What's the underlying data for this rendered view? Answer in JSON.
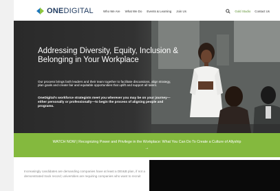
{
  "header": {
    "logo_bold": "ONE",
    "logo_light": "DIGITAL",
    "nav": [
      "Who We Are",
      "What We Do",
      "Events & Learning",
      "Join Us"
    ],
    "gold_link": "Gold Studio",
    "contact_link": "Contact Us"
  },
  "hero": {
    "title": "Addressing Diversity, Equity, Inclusion & Belonging in Your Workplace",
    "lead": "Our process brings both leaders and their team together to facilitate discussions, align strategy, plan goals and create fair and equitable opportunities that uplift and support all talent.",
    "lead2": "OneDigital's workforce strategists meet you wherever you may be on your journey—either personally or professionally—to begin the process of aligning people and programs."
  },
  "banner": {
    "text": "WATCH NOW | Recognizing Power and Privilege in the Workplace: What You Can Do To Create a Culture of Allyship",
    "arrow": "→"
  },
  "lower": {
    "paragraph": "Increasingly candidates are demanding companies have at least a DEI&B plan, if not a demonstrated track record; universities are requiring companies who want to recruit"
  },
  "colors": {
    "brand_blue": "#1b75bb",
    "brand_green": "#8dc63f",
    "banner_green": "#84b93e",
    "hero_dark": "#2a2a2a"
  }
}
